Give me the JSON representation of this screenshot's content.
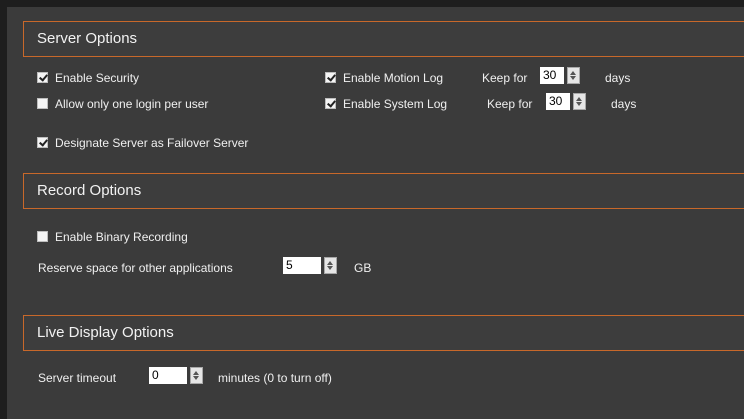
{
  "server_options": {
    "title": "Server Options",
    "enable_security": {
      "label": "Enable Security",
      "checked": true
    },
    "one_login": {
      "label": "Allow only one login per user",
      "checked": false
    },
    "failover": {
      "label": "Designate Server as Failover Server",
      "checked": true
    },
    "motion_log": {
      "label": "Enable Motion Log",
      "checked": true,
      "keep_label": "Keep for",
      "value": "30",
      "unit": "days"
    },
    "system_log": {
      "label": "Enable System Log",
      "checked": true,
      "keep_label": "Keep for",
      "value": "30",
      "unit": "days"
    }
  },
  "record_options": {
    "title": "Record Options",
    "binary_recording": {
      "label": "Enable Binary Recording",
      "checked": false
    },
    "reserve": {
      "label": "Reserve space for other applications",
      "value": "5",
      "unit": "GB"
    }
  },
  "live_display_options": {
    "title": "Live Display Options",
    "timeout": {
      "label": "Server timeout",
      "value": "0",
      "unit": "minutes (0 to turn off)"
    }
  },
  "colors": {
    "accent": "#c8682a",
    "background": "#3b3b3b"
  }
}
